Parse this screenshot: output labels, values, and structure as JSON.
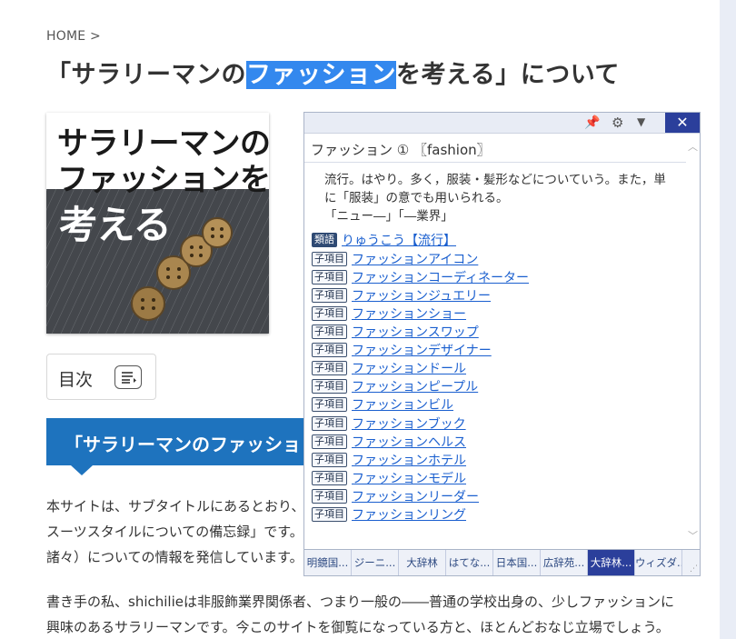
{
  "breadcrumb": {
    "home": "HOME",
    "separator": ">"
  },
  "title": {
    "before": "「サラリーマンの",
    "highlight": "ファッション",
    "after": "を考える」について"
  },
  "thumbnail": {
    "line1": "サラリーマンの",
    "line2": "ファッションを",
    "line3": "考える"
  },
  "toc": {
    "label": "目次",
    "icon": "list-icon"
  },
  "section_heading": "「サラリーマンのファッショ",
  "paragraphs": {
    "p1_l1": "本サイトは、サブタイトルにあるとおり、",
    "p1_l2": "スーツスタイルについての備忘録」です。",
    "p1_l3": "諸々）についての情報を発信しています。",
    "p2_l1": "書き手の私、shichilieは非服飾業界関係者、つまり一般の――普通の学校出身の、少しファッションに",
    "p2_l2": "興味のあるサラリーマンです。今このサイトを御覧になっている方と、ほとんどおなじ立場でしょう。"
  },
  "popup": {
    "icons": {
      "pin": "pin-icon",
      "settings": "gear-icon",
      "menu": "chevron-down-icon",
      "close": "close-icon"
    },
    "close_label": "✕",
    "headword": "ファッション ① 〖fashion〗",
    "definition": [
      "流行。はやり。多く，服装・髪形などについていう。また，単",
      "に「服装」の意でも用いられる。",
      "「ニュー―」「―業界」"
    ],
    "synonym": {
      "tag": "類語",
      "link": "りゅうこう【流行】"
    },
    "sub_tag": "子項目",
    "sub_entries": [
      "ファッションアイコン",
      "ファッションコーディネーター",
      "ファッションジュエリー",
      "ファッションショー",
      "ファッションスワップ",
      "ファッションデザイナー",
      "ファッションドール",
      "ファッションピープル",
      "ファッションビル",
      "ファッションブック",
      "ファッションヘルス",
      "ファッションホテル",
      "ファッションモデル",
      "ファッションリーダー",
      "ファッションリング"
    ],
    "tabs": [
      "明鏡国...",
      "ジーニ...",
      "大辞林",
      "はてな...",
      "日本国...",
      "広辞苑...",
      "大辞林...",
      "ウィズダ..."
    ],
    "active_tab": 6
  },
  "colors": {
    "accent": "#1e73be",
    "highlight": "#3388ee",
    "popup_active": "#2b3f9b",
    "link": "#1a5fcf"
  }
}
